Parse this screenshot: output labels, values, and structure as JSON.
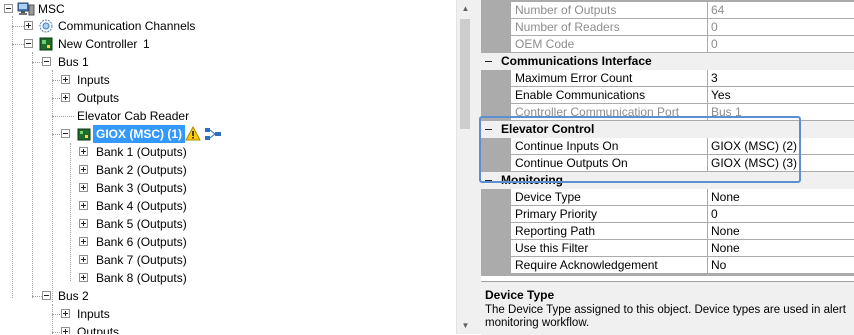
{
  "tree": {
    "root": "MSC",
    "communication_channels": "Communication Channels",
    "new_controller": "New Controller",
    "new_controller_number": "1",
    "bus1": "Bus 1",
    "inputs": "Inputs",
    "outputs": "Outputs",
    "elevator_cab_reader": "Elevator Cab Reader",
    "giox": "GIOX (MSC) (1)",
    "banks": [
      "Bank 1 (Outputs)",
      "Bank 2 (Outputs)",
      "Bank 3 (Outputs)",
      "Bank 4 (Outputs)",
      "Bank 5 (Outputs)",
      "Bank 6 (Outputs)",
      "Bank 7 (Outputs)",
      "Bank 8 (Outputs)"
    ],
    "bus2": "Bus 2",
    "bus2_inputs": "Inputs",
    "bus2_outputs": "Outputs"
  },
  "grid": {
    "rows_top": [
      {
        "name": "Number of Outputs",
        "value": "64"
      },
      {
        "name": "Number of Readers",
        "value": "0"
      },
      {
        "name": "OEM Code",
        "value": "0"
      }
    ],
    "comm_title": "Communications Interface",
    "comm_rows": [
      {
        "name": "Maximum Error Count",
        "value": "3"
      },
      {
        "name": "Enable Communications",
        "value": "Yes"
      },
      {
        "name": "Controller Communication Port",
        "value": "Bus 1"
      }
    ],
    "elevator_title": "Elevator Control",
    "elevator_rows": [
      {
        "name": "Continue Inputs On",
        "value": "GIOX (MSC) (2)"
      },
      {
        "name": "Continue Outputs On",
        "value": "GIOX (MSC) (3)"
      }
    ],
    "monitoring_title": "Monitoring",
    "monitoring_rows": [
      {
        "name": "Device Type",
        "value": "None"
      },
      {
        "name": "Primary Priority",
        "value": "0"
      },
      {
        "name": "Reporting Path",
        "value": "None"
      },
      {
        "name": "Use this Filter",
        "value": "None"
      },
      {
        "name": "Require Acknowledgement",
        "value": "No"
      }
    ]
  },
  "description": {
    "title": "Device Type",
    "text": "The Device Type assigned to this object. Device types are used in alert monitoring workflow."
  },
  "colors": {
    "selection": "#3399ff",
    "highlight_border": "#5b8fd2",
    "grid_line": "#ababab"
  }
}
